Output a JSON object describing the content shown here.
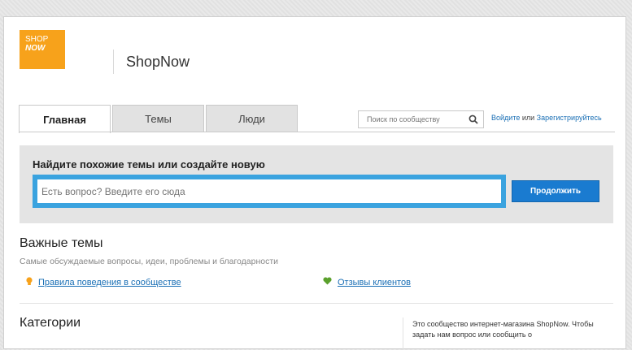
{
  "logo": {
    "line1": "SHOP",
    "line2": "NOW"
  },
  "brand": "ShopNow",
  "tabs": [
    {
      "label": "Главная",
      "active": true
    },
    {
      "label": "Темы",
      "active": false
    },
    {
      "label": "Люди",
      "active": false
    }
  ],
  "search": {
    "placeholder": "Поиск по сообществу",
    "icon": "search-icon"
  },
  "auth": {
    "login": "Войдите",
    "or": " или ",
    "register": "Зарегистрируйтесь"
  },
  "ask": {
    "title": "Найдите похожие темы или создайте новую",
    "placeholder": "Есть вопрос? Введите его сюда",
    "button": "Продолжить"
  },
  "important": {
    "title": "Важные темы",
    "subtitle": "Самые обсуждаемые вопросы, идеи, проблемы и благодарности",
    "links": [
      {
        "label": "Правила поведения в сообществе",
        "icon": "lightbulb-icon"
      },
      {
        "label": "Отзывы клиентов",
        "icon": "heart-icon"
      }
    ]
  },
  "categories": {
    "title": "Категории"
  },
  "about": {
    "text": "Это сообщество интернет-магазина ShopNow. Чтобы задать нам вопрос или сообщить о"
  },
  "colors": {
    "logo": "#f7a21b",
    "accent": "#1a7bd0",
    "ask_border": "#3aa3df",
    "link": "#1a6fb5",
    "lightbulb": "#f7a21b",
    "heart": "#5aa02c"
  }
}
